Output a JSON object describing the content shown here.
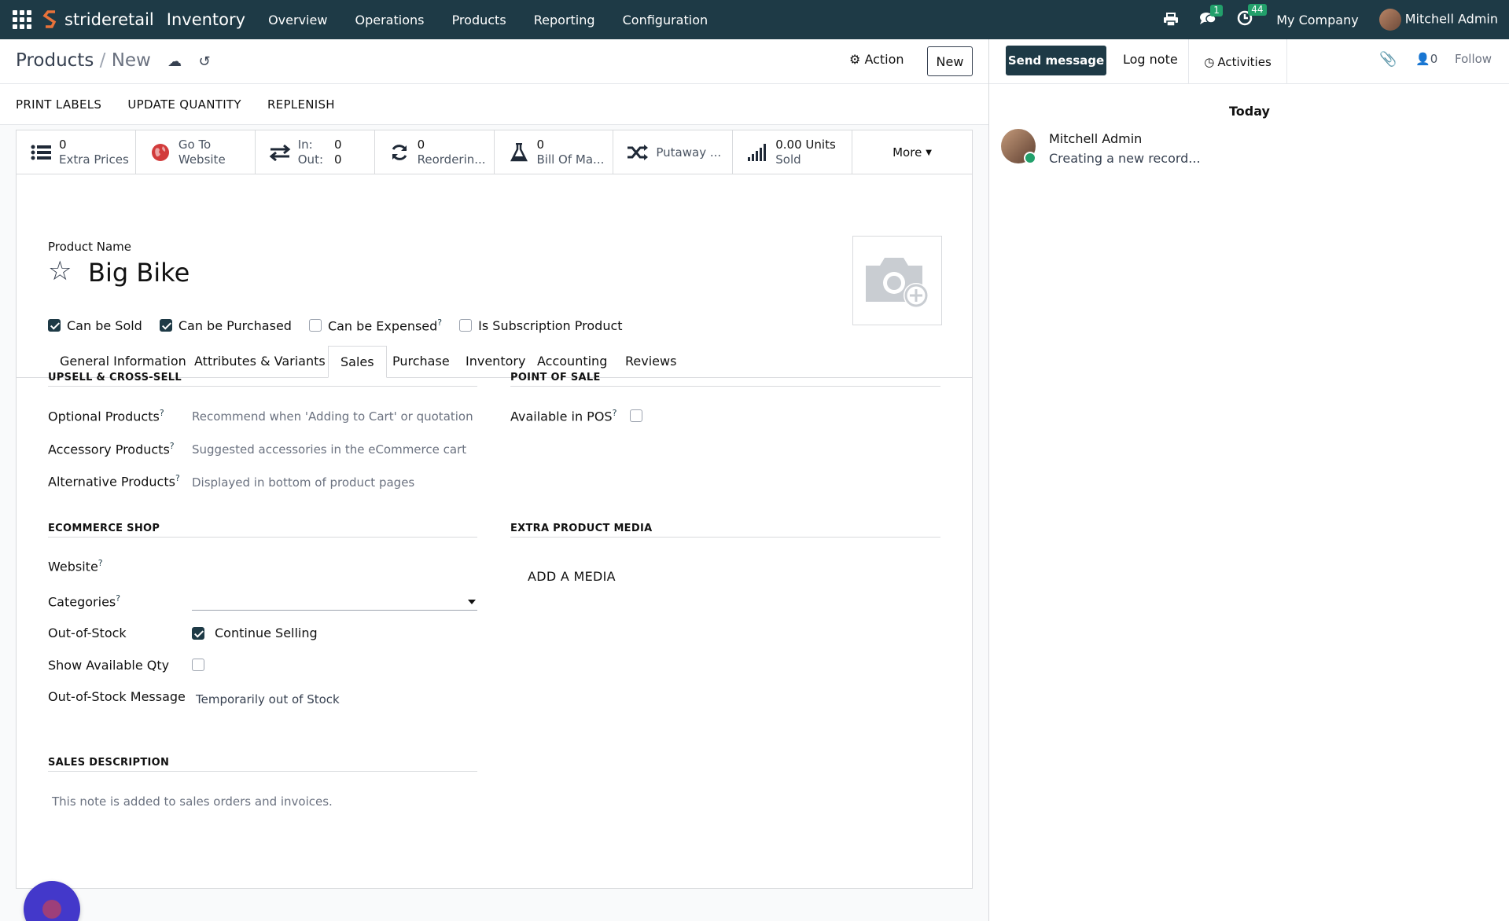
{
  "topbar": {
    "brand": "strideretail",
    "app": "Inventory",
    "menu": [
      "Overview",
      "Operations",
      "Products",
      "Reporting",
      "Configuration"
    ],
    "messages_count": "1",
    "activities_count": "44",
    "company": "My Company",
    "user": "Mitchell Admin"
  },
  "control_panel": {
    "breadcrumb_root": "Products",
    "breadcrumb_current": "New",
    "action_label": "Action",
    "new_label": "New"
  },
  "buttons": [
    "PRINT LABELS",
    "UPDATE QUANTITY",
    "REPLENISH"
  ],
  "smart_buttons": {
    "extra_prices": {
      "value": "0",
      "label": "Extra Prices"
    },
    "website": {
      "value": "Go To",
      "label": "Website"
    },
    "inout": {
      "in_label": "In:",
      "in_value": "0",
      "out_label": "Out:",
      "out_value": "0"
    },
    "reordering": {
      "value": "0",
      "label": "Reorderin..."
    },
    "bom": {
      "value": "0",
      "label": "Bill Of Ma..."
    },
    "putaway": {
      "label": "Putaway ..."
    },
    "sold": {
      "value": "0.00 Units",
      "label": "Sold"
    },
    "more": "More"
  },
  "product": {
    "name_label": "Product Name",
    "name": "Big Bike",
    "can_be_sold": "Can be Sold",
    "can_be_purchased": "Can be Purchased",
    "can_be_expensed": "Can be Expensed",
    "is_subscription": "Is Subscription Product"
  },
  "tabs": [
    "General Information",
    "Attributes & Variants",
    "Sales",
    "Purchase",
    "Inventory",
    "Accounting",
    "Reviews"
  ],
  "sales": {
    "upsell_title": "UPSELL & CROSS-SELL",
    "optional_label": "Optional Products",
    "optional_placeholder": "Recommend when 'Adding to Cart' or quotation",
    "accessory_label": "Accessory Products",
    "accessory_placeholder": "Suggested accessories in the eCommerce cart",
    "alternative_label": "Alternative Products",
    "alternative_placeholder": "Displayed in bottom of product pages",
    "pos_title": "POINT OF SALE",
    "available_pos_label": "Available in POS",
    "ecommerce_title": "ECOMMERCE SHOP",
    "website_label": "Website",
    "categories_label": "Categories",
    "oos_label": "Out-of-Stock",
    "continue_selling": "Continue Selling",
    "show_qty_label": "Show Available Qty",
    "oos_msg_label": "Out-of-Stock Message",
    "oos_msg_value": "Temporarily out of Stock",
    "media_title": "EXTRA PRODUCT MEDIA",
    "add_media": "ADD A MEDIA",
    "desc_title": "SALES DESCRIPTION",
    "desc_placeholder": "This note is added to sales orders and invoices."
  },
  "chatter": {
    "send_message": "Send message",
    "log_note": "Log note",
    "activities": "Activities",
    "followers": "0",
    "follow": "Follow",
    "today": "Today",
    "author": "Mitchell Admin",
    "message": "Creating a new record..."
  },
  "colors": {
    "navbar": "#1e3a46",
    "primary": "#1e3a46",
    "badge": "#22a06b",
    "bubble": "#4338ca"
  }
}
